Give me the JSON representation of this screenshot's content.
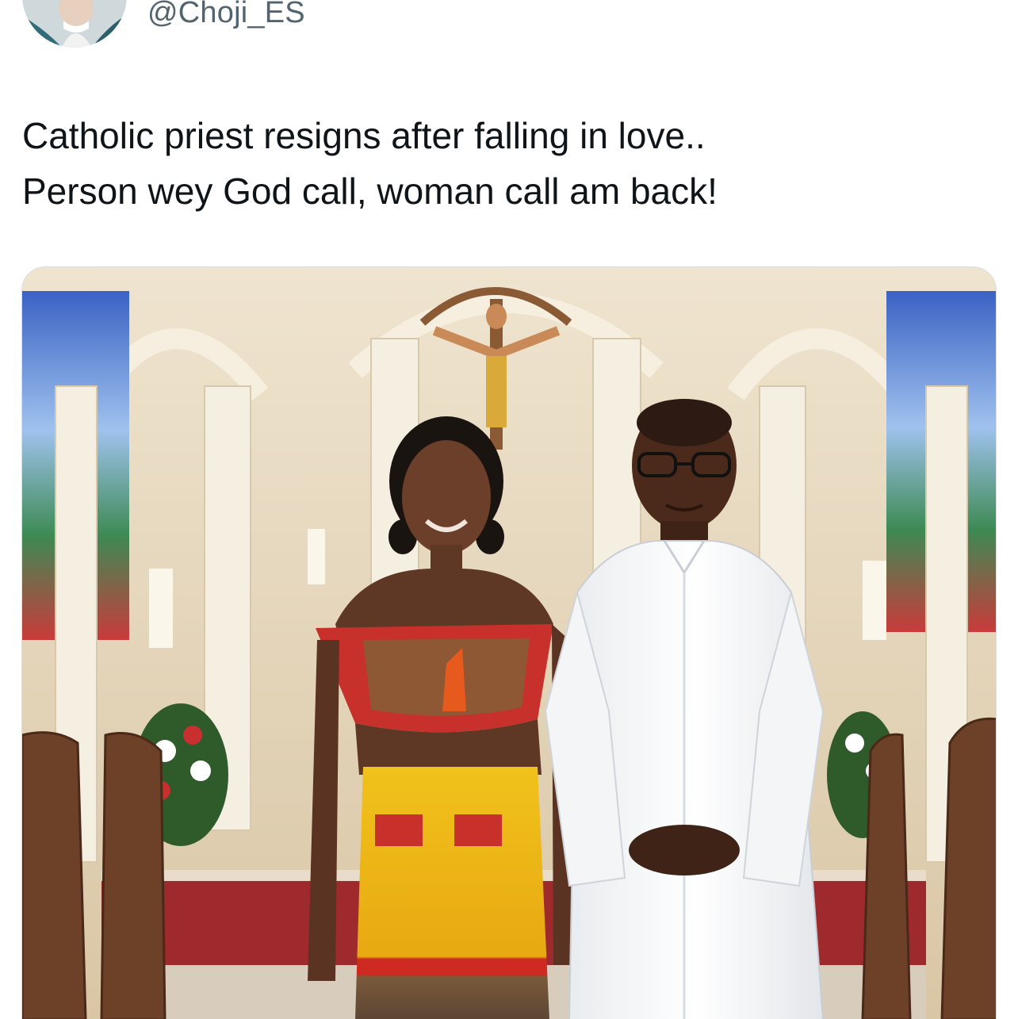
{
  "tweet": {
    "handle": "@Choji_ES",
    "text_line_1": "Catholic priest resigns after falling in love..",
    "text_line_2": "Person wey God call, woman call am back!"
  },
  "colors": {
    "text_primary": "#0f1419",
    "text_secondary": "#536471",
    "background": "#ffffff"
  },
  "icons": {
    "avatar": "user-avatar-photo"
  }
}
